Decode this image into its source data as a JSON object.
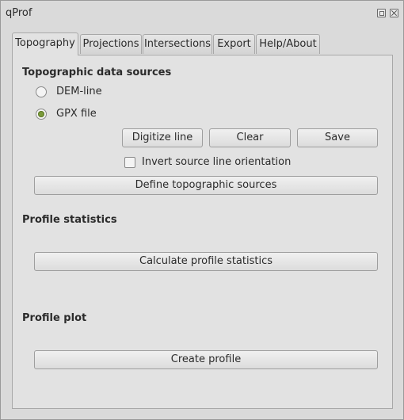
{
  "window": {
    "title": "qProf",
    "float_icon": "float-icon",
    "close_icon": "close-icon"
  },
  "tabs": [
    {
      "label": "Topography",
      "active": true
    },
    {
      "label": "Projections",
      "active": false
    },
    {
      "label": "Intersections",
      "active": false
    },
    {
      "label": "Export",
      "active": false
    },
    {
      "label": "Help/About",
      "active": false
    }
  ],
  "topography": {
    "sources_title": "Topographic data sources",
    "radio_dem": {
      "label": "DEM-line",
      "checked": false
    },
    "radio_gpx": {
      "label": "GPX file",
      "checked": true
    },
    "digitize_label": "Digitize line",
    "clear_label": "Clear",
    "save_label": "Save",
    "invert_label": "Invert source line orientation",
    "invert_checked": false,
    "define_label": "Define topographic sources",
    "stats_title": "Profile statistics",
    "calc_label": "Calculate profile statistics",
    "plot_title": "Profile plot",
    "create_label": "Create profile"
  },
  "colors": {
    "radio_checked": "#7a9a3a",
    "panel_bg": "#e2e2e2"
  }
}
